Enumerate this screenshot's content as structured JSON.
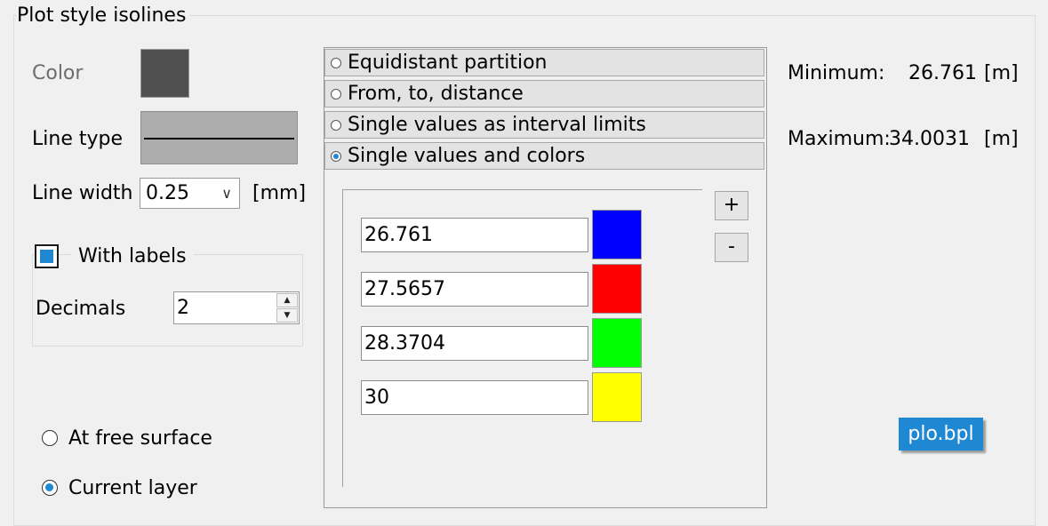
{
  "group": {
    "title": "Plot style isolines"
  },
  "color": {
    "label": "Color",
    "swatch": "#505050"
  },
  "line_type": {
    "label": "Line type"
  },
  "line_width": {
    "label": "Line width",
    "value": "0.25",
    "unit": "[mm]"
  },
  "labels": {
    "label": "With labels",
    "checked": true
  },
  "decimals": {
    "label": "Decimals",
    "value": "2"
  },
  "position": {
    "free_surface": "At free surface",
    "current_layer": "Current layer",
    "selected": "current_layer"
  },
  "modes": {
    "items": [
      {
        "label": "Equidistant partition",
        "selected": false
      },
      {
        "label": "From, to, distance",
        "selected": false
      },
      {
        "label": "Single values as interval limits",
        "selected": false
      },
      {
        "label": "Single values and colors",
        "selected": true
      }
    ]
  },
  "values": [
    {
      "value": "26.761",
      "color": "#0000ff"
    },
    {
      "value": "27.5657",
      "color": "#ff0000"
    },
    {
      "value": "28.3704",
      "color": "#00ff00"
    },
    {
      "value": "30",
      "color": "#ffff00"
    }
  ],
  "buttons": {
    "add": "+",
    "remove": "-"
  },
  "range": {
    "min_label": "Minimum:",
    "min_value": "26.761",
    "max_label": "Maximum:",
    "max_value": "34.0031",
    "unit": "[m]"
  },
  "tooltip": "plo.bpl"
}
